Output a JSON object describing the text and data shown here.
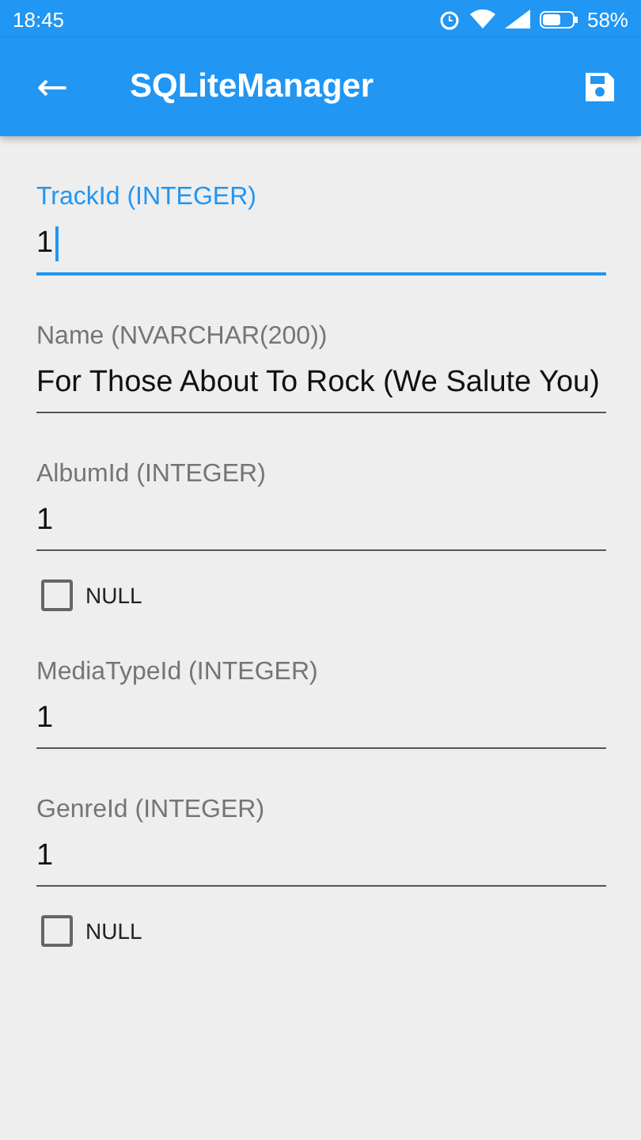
{
  "status_bar": {
    "time": "18:45",
    "battery": "58%"
  },
  "app_bar": {
    "back": "←",
    "title": "SQLiteManager"
  },
  "fields": [
    {
      "label": "TrackId (INTEGER)",
      "value": "1",
      "focused": true
    },
    {
      "label": "Name (NVARCHAR(200))",
      "value": "For Those About To Rock (We Salute You)",
      "focused": false
    },
    {
      "label": "AlbumId (INTEGER)",
      "value": "1",
      "focused": false,
      "null_option": {
        "label": "NULL",
        "checked": false
      }
    },
    {
      "label": "MediaTypeId (INTEGER)",
      "value": "1",
      "focused": false
    },
    {
      "label": "GenreId (INTEGER)",
      "value": "1",
      "focused": false,
      "null_option": {
        "label": "NULL",
        "checked": false
      }
    }
  ]
}
